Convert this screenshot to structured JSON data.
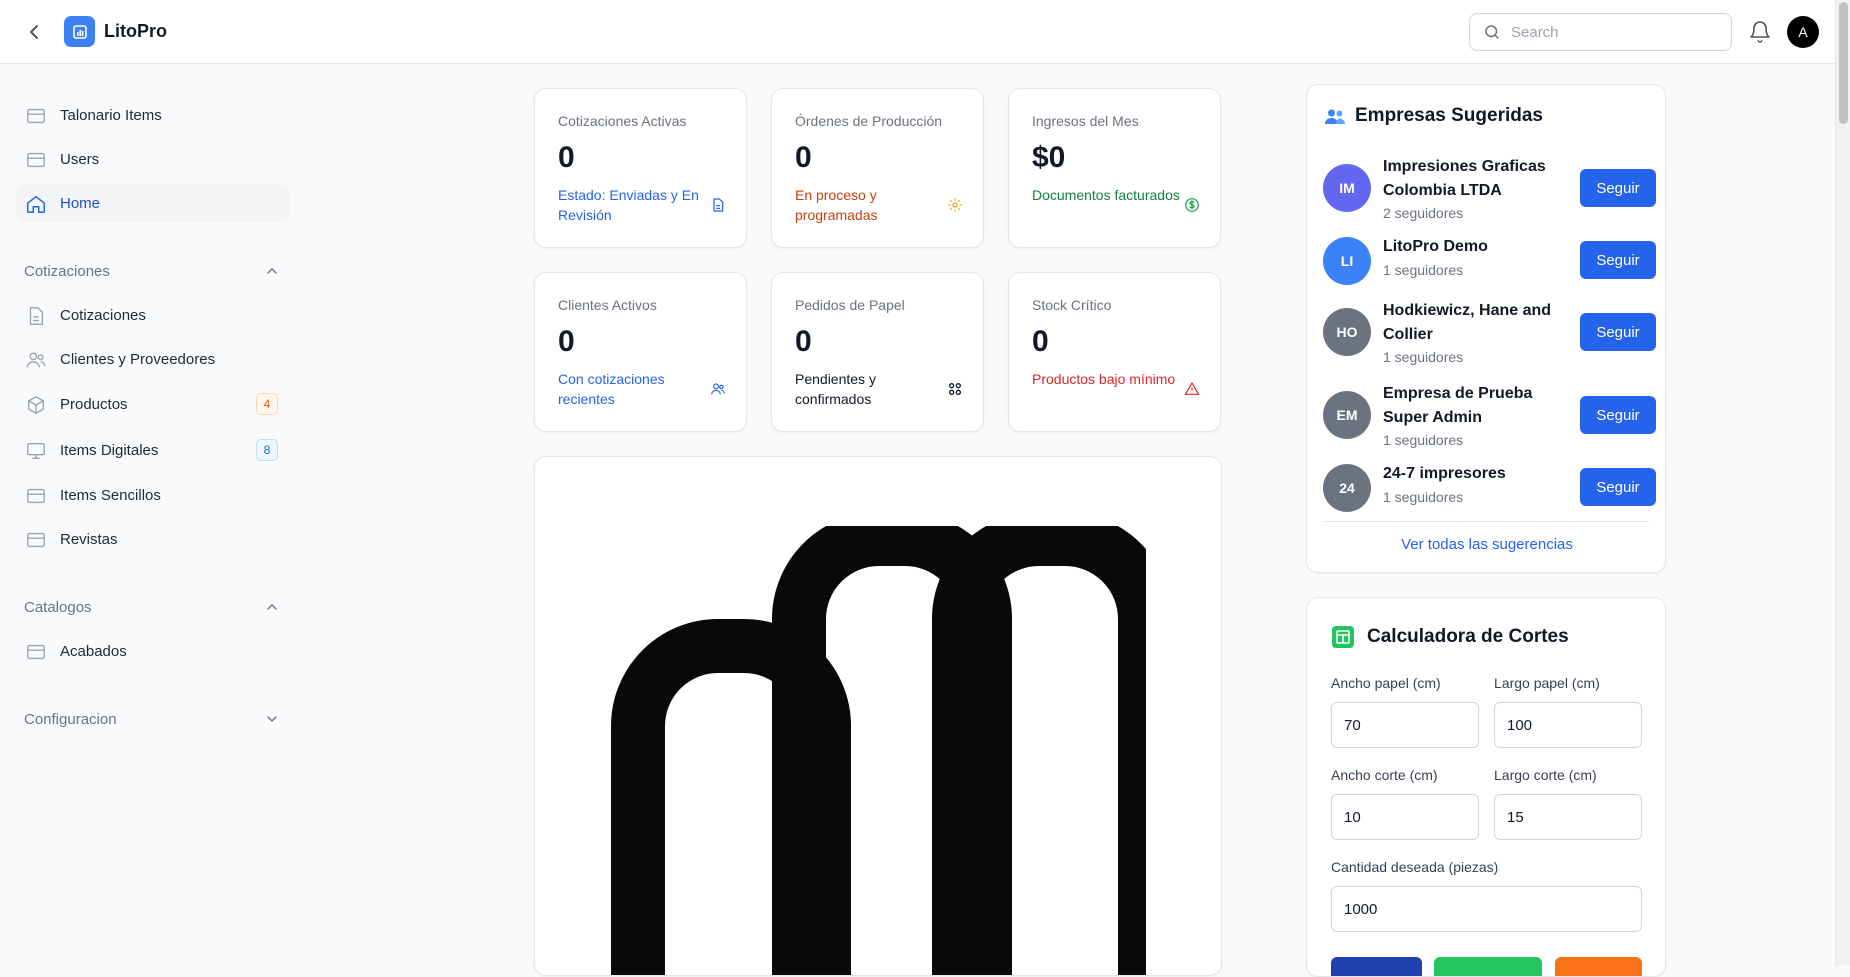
{
  "app": {
    "title": "LitoPro"
  },
  "header": {
    "search_placeholder": "Search",
    "avatar_initial": "A"
  },
  "sidebar": {
    "items": [
      {
        "label": "Talonario Items"
      },
      {
        "label": "Users"
      },
      {
        "label": "Home",
        "active": true
      }
    ],
    "groups": [
      {
        "label": "Cotizaciones",
        "items": [
          {
            "label": "Cotizaciones"
          },
          {
            "label": "Clientes y Proveedores"
          },
          {
            "label": "Productos",
            "badge": "4",
            "badge_color": "#ea580c"
          },
          {
            "label": "Items Digitales",
            "badge": "8",
            "badge_color": "#2563eb"
          },
          {
            "label": "Items Sencillos"
          },
          {
            "label": "Revistas"
          }
        ]
      },
      {
        "label": "Catalogos",
        "items": [
          {
            "label": "Acabados"
          }
        ]
      },
      {
        "label": "Configuracion",
        "items": []
      }
    ]
  },
  "stats": [
    {
      "label": "Cotizaciones Activas",
      "value": "0",
      "desc": "Estado: Enviadas y En Revisión",
      "color": "#2563eb",
      "icon": "document-icon"
    },
    {
      "label": "Órdenes de Producción",
      "value": "0",
      "desc": "En proceso y programadas",
      "color": "#c2410c",
      "icon": "gear-icon"
    },
    {
      "label": "Ingresos del Mes",
      "value": "$0",
      "desc": "Documentos facturados",
      "color": "#15803d",
      "icon": "dollar-icon"
    },
    {
      "label": "Clientes Activos",
      "value": "0",
      "desc": "Con cotizaciones recientes",
      "color": "#2563eb",
      "icon": "users-icon"
    },
    {
      "label": "Pedidos de Papel",
      "value": "0",
      "desc": "Pendientes y confirmados",
      "color": "#111827",
      "icon": "grid-icon"
    },
    {
      "label": "Stock Crítico",
      "value": "0",
      "desc": "Productos bajo mínimo",
      "color": "#dc2626",
      "icon": "warning-icon"
    }
  ],
  "empresas": {
    "title": "Empresas Sugeridas",
    "button_label": "Seguir",
    "see_all": "Ver todas las sugerencias",
    "items": [
      {
        "initials": "IM",
        "name": "Impresiones Graficas Colombia LTDA",
        "followers": "2 seguidores",
        "color": "#6366f1"
      },
      {
        "initials": "LI",
        "name": "LitoPro Demo",
        "followers": "1 seguidores",
        "color": "#3b82f6"
      },
      {
        "initials": "HO",
        "name": "Hodkiewicz, Hane and Collier",
        "followers": "1 seguidores",
        "color": "#6b7280"
      },
      {
        "initials": "EM",
        "name": "Empresa de Prueba Super Admin",
        "followers": "1 seguidores",
        "color": "#6b7280"
      },
      {
        "initials": "24",
        "name": "24-7 impresores",
        "followers": "1 seguidores",
        "color": "#6b7280"
      }
    ]
  },
  "calculadora": {
    "title": "Calculadora de Cortes",
    "ancho_papel": {
      "label": "Ancho papel (cm)",
      "value": "70"
    },
    "largo_papel": {
      "label": "Largo papel (cm)",
      "value": "100"
    },
    "ancho_corte": {
      "label": "Ancho corte (cm)",
      "value": "10"
    },
    "largo_corte": {
      "label": "Largo corte (cm)",
      "value": "15"
    },
    "cantidad": {
      "label": "Cantidad deseada (piezas)",
      "value": "1000"
    },
    "button_colors": [
      "#1e40af",
      "#22c55e",
      "#f97316"
    ]
  }
}
